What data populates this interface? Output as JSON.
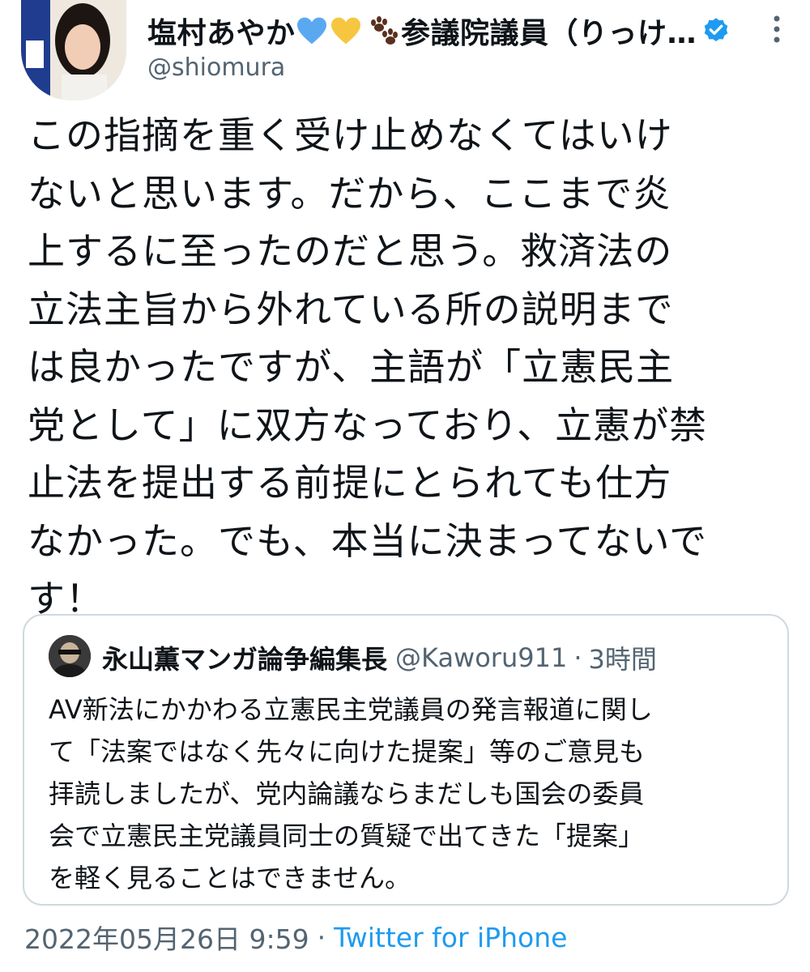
{
  "author": {
    "name": "塩村あやか",
    "name_suffix": "参議院議員（りっけ…",
    "handle": "@shiomura",
    "emoji_icons": [
      "blue-heart-icon",
      "yellow-heart-icon",
      "paw-prints-icon"
    ],
    "verified_icon": "verified-badge-icon",
    "more_icon": "more-options-icon"
  },
  "tweet": {
    "text": "この指摘を重く受け止めなくてはいけ\nないと思います。だから、ここまで炎\n上するに至ったのだと思う。救済法の\n立法主旨から外れている所の説明まで\nは良かったですが、主語が「立憲民主\n党として」に双方なっており、立憲が禁\n止法を提出する前提にとられても仕方\nなかった。でも、本当に決まってないで\nす！"
  },
  "quoted_tweet": {
    "name": "永山薫マンガ論争編集長",
    "handle": "@Kaworu911",
    "separator": "·",
    "time": "3時間",
    "text": "AV新法にかかわる立憲民主党議員の発言報道に関し\nて「法案ではなく先々に向けた提案」等のご意見も\n拝読しましたが、党内論議ならまだしも国会の委員\n会で立憲民主党議員同士の質疑で出てきた「提案」\nを軽く見ることはできません。"
  },
  "footer": {
    "date": "2022年05月26日 9:59",
    "separator": "·",
    "source": "Twitter for iPhone"
  },
  "colors": {
    "text": "#0f1419",
    "secondary": "#536471",
    "link": "#1d9bf0",
    "border": "#cfd9de",
    "blue_heart": "#5aa9f0",
    "yellow_heart": "#f6c640"
  }
}
